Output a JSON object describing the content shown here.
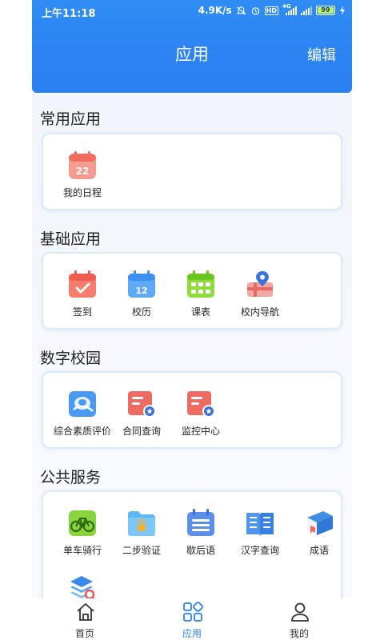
{
  "status": {
    "time": "上午11:18",
    "speed": "4.9K/s",
    "hd": "HD",
    "network": "4G",
    "battery": "99"
  },
  "header": {
    "title": "应用",
    "edit": "编辑"
  },
  "sections": [
    {
      "title": "常用应用",
      "apps": [
        {
          "label": "我的日程",
          "date": "22"
        }
      ]
    },
    {
      "title": "基础应用",
      "apps": [
        {
          "label": "签到"
        },
        {
          "label": "校历",
          "date": "12"
        },
        {
          "label": "课表"
        },
        {
          "label": "校内导航"
        }
      ]
    },
    {
      "title": "数字校园",
      "apps": [
        {
          "label": "综合素质评价"
        },
        {
          "label": "合同查询"
        },
        {
          "label": "监控中心"
        }
      ]
    },
    {
      "title": "公共服务",
      "apps": [
        {
          "label": "单车骑行"
        },
        {
          "label": "二步验证"
        },
        {
          "label": "歇后语"
        },
        {
          "label": "汉字查询"
        },
        {
          "label": "成语"
        }
      ]
    }
  ],
  "tabbar": [
    {
      "label": "首页",
      "icon": "home-icon",
      "active": false
    },
    {
      "label": "应用",
      "icon": "apps-grid-icon",
      "active": true
    },
    {
      "label": "我的",
      "icon": "person-icon",
      "active": false
    }
  ],
  "colors": {
    "accent": "#2a7ff0",
    "header": "#2f8cf5",
    "card_border": "#dde9f6"
  }
}
